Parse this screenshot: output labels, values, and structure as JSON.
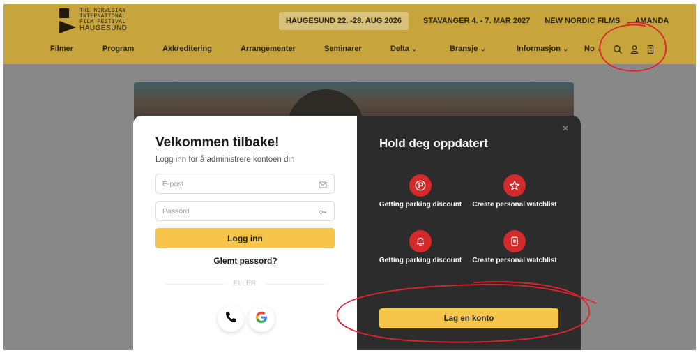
{
  "header": {
    "logo_lines": [
      "THE NORWEGIAN",
      "INTERNATIONAL",
      "FILM FESTIVAL"
    ],
    "logo_city": "HAUGESUND",
    "top_links": [
      {
        "label": "HAUGESUND 22. -28. AUG 2026",
        "active": true
      },
      {
        "label": "STAVANGER 4. - 7. MAR 2027",
        "active": false
      },
      {
        "label": "NEW NORDIC FILMS",
        "active": false
      },
      {
        "label": "AMANDA",
        "active": false
      }
    ],
    "nav": [
      {
        "label": "Filmer",
        "dropdown": false
      },
      {
        "label": "Program",
        "dropdown": false
      },
      {
        "label": "Akkreditering",
        "dropdown": false
      },
      {
        "label": "Arrangementer",
        "dropdown": false
      },
      {
        "label": "Seminarer",
        "dropdown": false
      },
      {
        "label": "Delta",
        "dropdown": true
      },
      {
        "label": "Bransje",
        "dropdown": true
      },
      {
        "label": "Informasjon",
        "dropdown": true
      },
      {
        "label": "No",
        "dropdown": true
      }
    ],
    "icons": [
      "search-icon",
      "user-icon",
      "ticket-icon"
    ]
  },
  "login": {
    "title": "Velkommen tilbake!",
    "subtitle": "Logg inn for å administrere kontoen din",
    "email_placeholder": "E-post",
    "password_placeholder": "Passord",
    "login_button": "Logg inn",
    "forgot": "Glemt passord?",
    "divider": "ELLER",
    "social": [
      "phone-icon",
      "google-icon"
    ]
  },
  "promo": {
    "title": "Hold deg oppdatert",
    "features": [
      {
        "label": "Getting parking discount",
        "icon": "parking-icon"
      },
      {
        "label": "Create personal watchlist",
        "icon": "star-icon"
      },
      {
        "label": "Getting parking discount",
        "icon": "bell-icon"
      },
      {
        "label": "Create personal watchlist",
        "icon": "ticket-icon"
      }
    ],
    "create_button": "Lag en konto"
  },
  "colors": {
    "header_bg": "#c7a43c",
    "accent_yellow": "#f7c54a",
    "accent_red": "#d52a2a",
    "dark_panel": "#2c2c2c",
    "annotation": "#e0242e"
  }
}
